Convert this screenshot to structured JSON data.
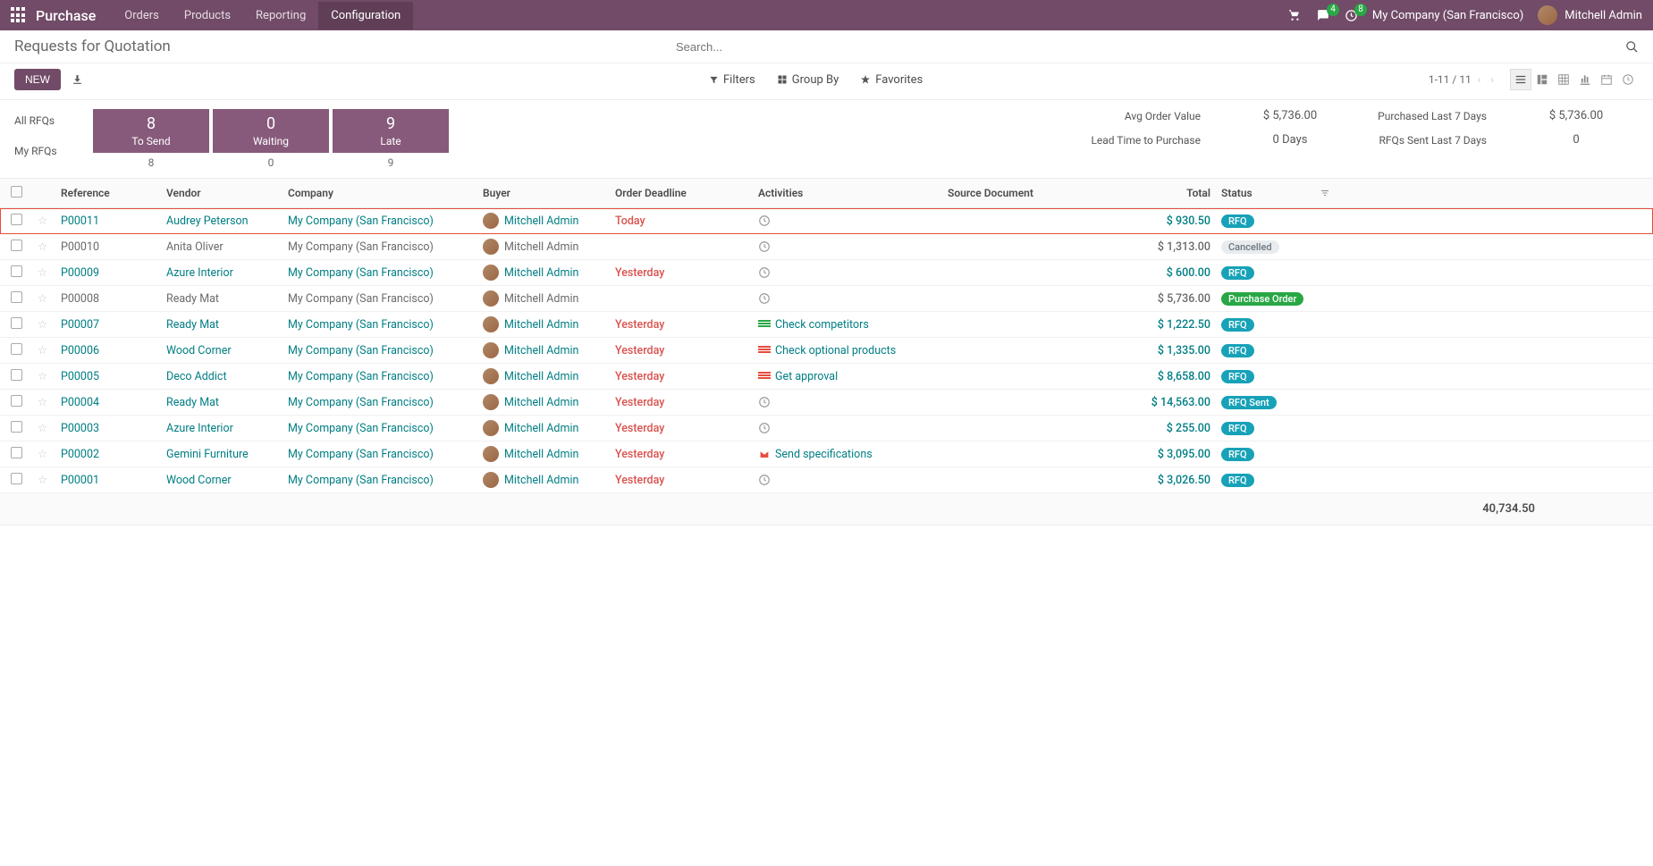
{
  "navbar": {
    "brand": "Purchase",
    "menu": [
      "Orders",
      "Products",
      "Reporting",
      "Configuration"
    ],
    "active_menu": "Configuration",
    "chat_badge": "4",
    "activity_badge": "8",
    "company": "My Company (San Francisco)",
    "user": "Mitchell Admin"
  },
  "page": {
    "title": "Requests for Quotation",
    "search_placeholder": "Search...",
    "new_button": "NEW",
    "filters_label": "Filters",
    "groupby_label": "Group By",
    "favorites_label": "Favorites",
    "pager": "1-11 / 11"
  },
  "dashboard": {
    "row1_label": "All RFQs",
    "row2_label": "My RFQs",
    "cards": [
      {
        "big": "8",
        "small": "To Send"
      },
      {
        "big": "0",
        "small": "Waiting"
      },
      {
        "big": "9",
        "small": "Late"
      }
    ],
    "row2_values": [
      "8",
      "0",
      "9"
    ],
    "stats_left": [
      {
        "label": "Avg Order Value",
        "value": "$ 5,736.00"
      },
      {
        "label": "Lead Time to Purchase",
        "value": "0 Days"
      }
    ],
    "stats_right": [
      {
        "label": "Purchased Last 7 Days",
        "value": "$ 5,736.00"
      },
      {
        "label": "RFQs Sent Last 7 Days",
        "value": "0"
      }
    ]
  },
  "table": {
    "headers": {
      "reference": "Reference",
      "vendor": "Vendor",
      "company": "Company",
      "buyer": "Buyer",
      "deadline": "Order Deadline",
      "activities": "Activities",
      "source": "Source Document",
      "total": "Total",
      "status": "Status"
    },
    "rows": [
      {
        "ref": "P00011",
        "vendor": "Audrey Peterson",
        "company": "My Company (San Francisco)",
        "buyer": "Mitchell Admin",
        "deadline": "Today",
        "activity_type": "clock",
        "activity_text": "",
        "total": "$ 930.50",
        "status": "RFQ",
        "status_class": "badge-rfq",
        "linked": true,
        "highlighted": true
      },
      {
        "ref": "P00010",
        "vendor": "Anita Oliver",
        "company": "My Company (San Francisco)",
        "buyer": "Mitchell Admin",
        "deadline": "",
        "activity_type": "clock",
        "activity_text": "",
        "total": "$ 1,313.00",
        "status": "Cancelled",
        "status_class": "badge-cancelled",
        "linked": false
      },
      {
        "ref": "P00009",
        "vendor": "Azure Interior",
        "company": "My Company (San Francisco)",
        "buyer": "Mitchell Admin",
        "deadline": "Yesterday",
        "activity_type": "clock",
        "activity_text": "",
        "total": "$ 600.00",
        "status": "RFQ",
        "status_class": "badge-rfq",
        "linked": true
      },
      {
        "ref": "P00008",
        "vendor": "Ready Mat",
        "company": "My Company (San Francisco)",
        "buyer": "Mitchell Admin",
        "deadline": "",
        "activity_type": "clock",
        "activity_text": "",
        "total": "$ 5,736.00",
        "status": "Purchase Order",
        "status_class": "badge-po",
        "linked": false
      },
      {
        "ref": "P00007",
        "vendor": "Ready Mat",
        "company": "My Company (San Francisco)",
        "buyer": "Mitchell Admin",
        "deadline": "Yesterday",
        "activity_type": "list-green",
        "activity_text": "Check competitors",
        "total": "$ 1,222.50",
        "status": "RFQ",
        "status_class": "badge-rfq",
        "linked": true
      },
      {
        "ref": "P00006",
        "vendor": "Wood Corner",
        "company": "My Company (San Francisco)",
        "buyer": "Mitchell Admin",
        "deadline": "Yesterday",
        "activity_type": "list-red",
        "activity_text": "Check optional products",
        "total": "$ 1,335.00",
        "status": "RFQ",
        "status_class": "badge-rfq",
        "linked": true
      },
      {
        "ref": "P00005",
        "vendor": "Deco Addict",
        "company": "My Company (San Francisco)",
        "buyer": "Mitchell Admin",
        "deadline": "Yesterday",
        "activity_type": "list-red",
        "activity_text": "Get approval",
        "total": "$ 8,658.00",
        "status": "RFQ",
        "status_class": "badge-rfq",
        "linked": true
      },
      {
        "ref": "P00004",
        "vendor": "Ready Mat",
        "company": "My Company (San Francisco)",
        "buyer": "Mitchell Admin",
        "deadline": "Yesterday",
        "activity_type": "clock",
        "activity_text": "",
        "total": "$ 14,563.00",
        "status": "RFQ Sent",
        "status_class": "badge-sent",
        "linked": true
      },
      {
        "ref": "P00003",
        "vendor": "Azure Interior",
        "company": "My Company (San Francisco)",
        "buyer": "Mitchell Admin",
        "deadline": "Yesterday",
        "activity_type": "clock",
        "activity_text": "",
        "total": "$ 255.00",
        "status": "RFQ",
        "status_class": "badge-rfq",
        "linked": true
      },
      {
        "ref": "P00002",
        "vendor": "Gemini Furniture",
        "company": "My Company (San Francisco)",
        "buyer": "Mitchell Admin",
        "deadline": "Yesterday",
        "activity_type": "envelope",
        "activity_text": "Send specifications",
        "total": "$ 3,095.00",
        "status": "RFQ",
        "status_class": "badge-rfq",
        "linked": true
      },
      {
        "ref": "P00001",
        "vendor": "Wood Corner",
        "company": "My Company (San Francisco)",
        "buyer": "Mitchell Admin",
        "deadline": "Yesterday",
        "activity_type": "clock",
        "activity_text": "",
        "total": "$ 3,026.50",
        "status": "RFQ",
        "status_class": "badge-rfq",
        "linked": true
      }
    ],
    "footer_total": "40,734.50"
  }
}
